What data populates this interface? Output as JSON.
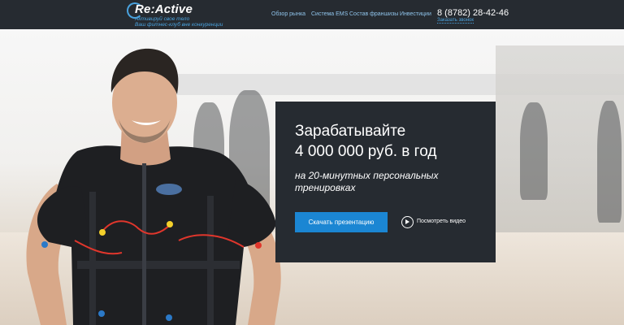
{
  "header": {
    "logo_title": "Re:Active",
    "logo_tagline_1": "Активируй свое тело",
    "logo_tagline_2": "Ваш фитнес-клуб вне конкуренции",
    "nav": [
      {
        "label": "Обзор рынка"
      },
      {
        "label": "Система EMS"
      },
      {
        "label": "Состав франшизы"
      },
      {
        "label": "Инвестиции"
      }
    ],
    "phone": "8 (8782) 28-42-46",
    "callback_label": "Заказать звонок"
  },
  "hero": {
    "headline_line1": "Зарабатывайте",
    "headline_line2": "4 000 000 руб. в год",
    "sub_line1": "на 20-минутных персональных",
    "sub_line2": "тренировках",
    "cta_label": "Скачать презентацию",
    "video_label": "Посмотреть видео"
  },
  "colors": {
    "header_bg": "#262b31",
    "accent": "#1b86d3",
    "link": "#8fc3ea",
    "card_bg": "#262b31"
  }
}
